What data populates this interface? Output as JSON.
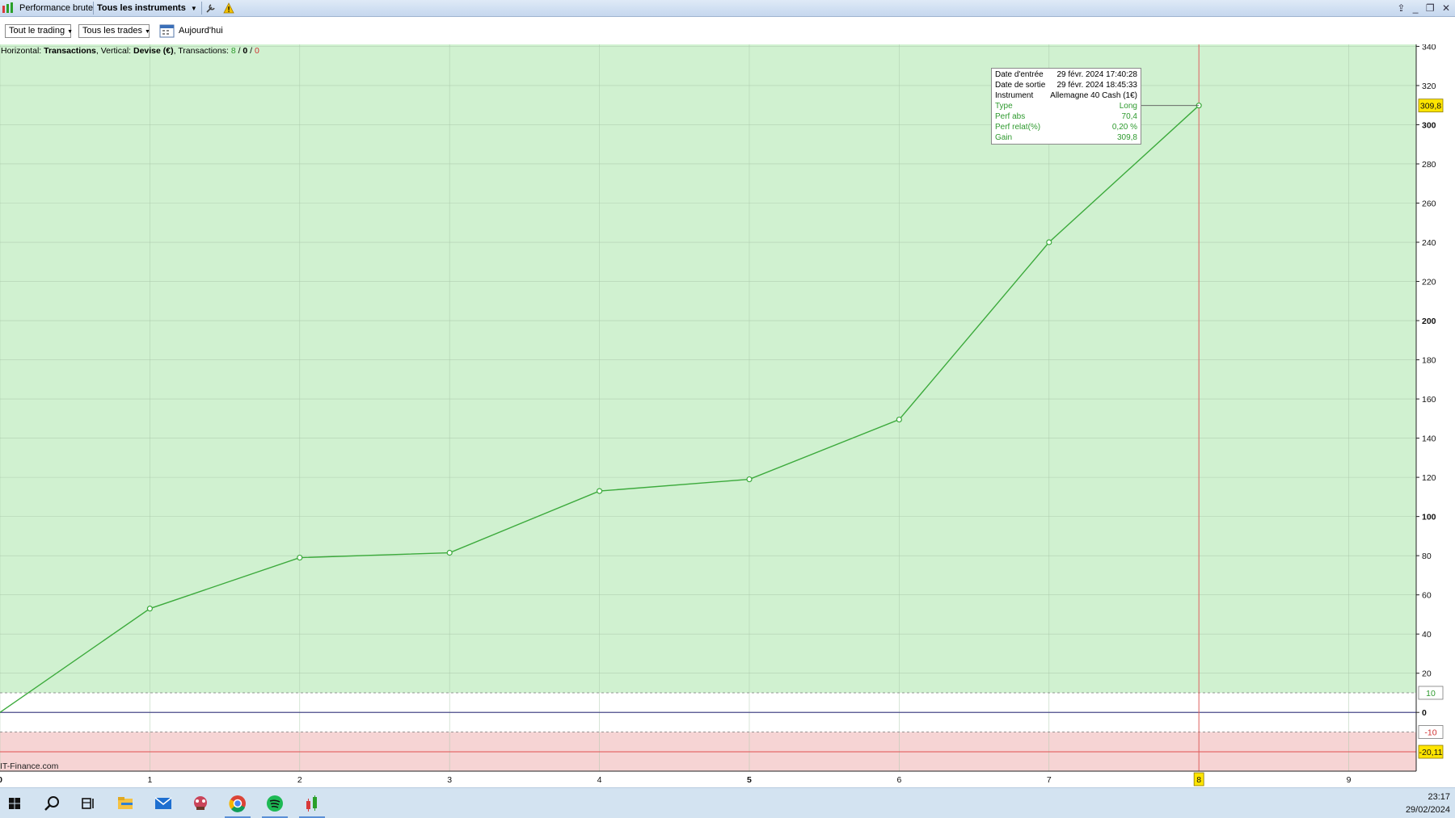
{
  "titlebar": {
    "app_label": "Performance brute",
    "instruments_label": "Tous les instruments"
  },
  "toolbar": {
    "trading_filter": "Tout le trading",
    "trades_filter": "Tous les trades",
    "date_label": "Aujourd'hui"
  },
  "info": {
    "horizontal_prefix": "Horizontal: ",
    "horizontal_value": "Transactions",
    "vertical_prefix": ", Vertical: ",
    "vertical_value": "Devise (€)",
    "transactions_prefix": ", Transactions: ",
    "tx_win": "8",
    "tx_sep1": " / ",
    "tx_neutral": "0",
    "tx_sep2": " / ",
    "tx_loss": "0"
  },
  "watermark": "IT-Finance.com",
  "tooltip": {
    "rows": [
      {
        "key": "Date d'entrée",
        "value": "29 févr. 2024 17:40:28"
      },
      {
        "key": "Date de sortie",
        "value": "29 févr. 2024 18:45:33"
      },
      {
        "key": "Instrument",
        "value": "Allemagne 40 Cash (1€)"
      },
      {
        "key": "Type",
        "value": "Long"
      },
      {
        "key": "Perf abs",
        "value": "70,4"
      },
      {
        "key": "Perf relat(%)",
        "value": "0,20 %"
      },
      {
        "key": "Gain",
        "value": "309,8"
      }
    ]
  },
  "chart_data": {
    "type": "line",
    "x": [
      0,
      1,
      2,
      3,
      4,
      5,
      6,
      7,
      8
    ],
    "values": [
      0,
      53,
      79,
      81.5,
      113,
      119,
      149.5,
      240,
      309.8
    ],
    "xlim": [
      0,
      9.45
    ],
    "ylim": [
      -30,
      341
    ],
    "x_ticks": [
      "0",
      "1",
      "2",
      "3",
      "4",
      "5",
      "6",
      "7",
      "8",
      "9"
    ],
    "y_ticks": [
      340,
      320,
      300,
      280,
      260,
      240,
      220,
      200,
      180,
      160,
      140,
      120,
      100,
      80,
      60,
      40,
      20,
      0
    ],
    "bold_y_ticks": [
      300,
      200,
      100,
      0
    ],
    "bold_x_ticks": [
      0,
      5
    ],
    "selected_x": 8,
    "selected_x_label": "8",
    "current_value_label": "309,8",
    "upper_threshold": 10,
    "upper_threshold_label": "10",
    "lower_threshold": -10,
    "lower_threshold_label": "-10",
    "min_line": -20.11,
    "min_line_label": "-20,11",
    "grid": true,
    "colors": {
      "profit_zone": "#d0f1d0",
      "loss_zone": "#f6d4d4",
      "line": "#3caa3c",
      "zero_line": "#4a4a8a",
      "min_line": "#e05050",
      "cursor": "#e06060",
      "highlight": "#ffe500"
    }
  },
  "taskbar": {
    "icons": [
      "windows-start-icon",
      "search-icon",
      "task-view-icon",
      "file-explorer-icon",
      "mail-icon",
      "game-icon",
      "chrome-icon",
      "spotify-icon",
      "trading-platform-icon"
    ],
    "time": "23:17",
    "date": "29/02/2024"
  }
}
